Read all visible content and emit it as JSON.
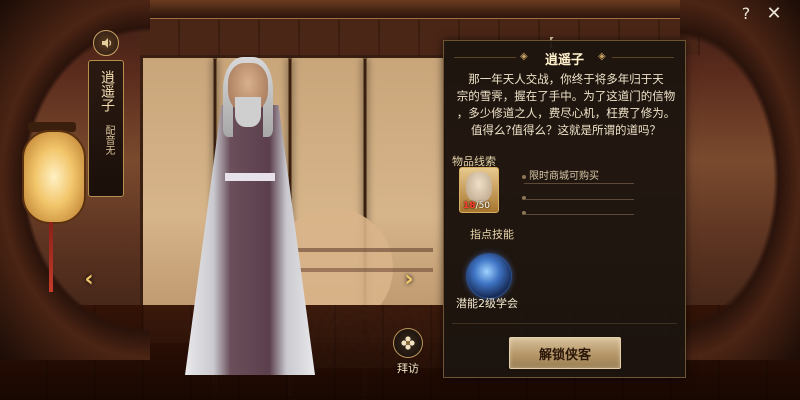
{
  "character": {
    "name": "逍遥子",
    "voice_label": "配音无"
  },
  "panel": {
    "bracket": "【",
    "title": "逍遥子",
    "bio_lines": [
      "那一年天人交战，你终于将多年归于天",
      "宗的雪霁，握在了手中。为了这道门的信物",
      "，多少修道之人，费尽心机，枉费了修为。",
      "值得么?值得么？这就是所谓的道吗？"
    ],
    "clue_section_label": "物品线索",
    "clue": {
      "have": "18",
      "need": "/50",
      "sources": [
        "限时商城可购买",
        "",
        ""
      ]
    },
    "skill_section_label": "指点技能",
    "skill_desc": "潜能2级学会",
    "unlock_button": "解锁侠客"
  },
  "visit": {
    "label": "拜访"
  },
  "toolbar": {
    "help": "?",
    "close": "✕"
  },
  "icons": {
    "voice": "speaker-icon",
    "visit": "flower-icon",
    "prev": "chevron-left-icon",
    "next": "chevron-right-icon"
  },
  "colors": {
    "accent_gold": "#c9a364",
    "count_red": "#ff3c2c",
    "button_bg": "#b89a6c"
  }
}
